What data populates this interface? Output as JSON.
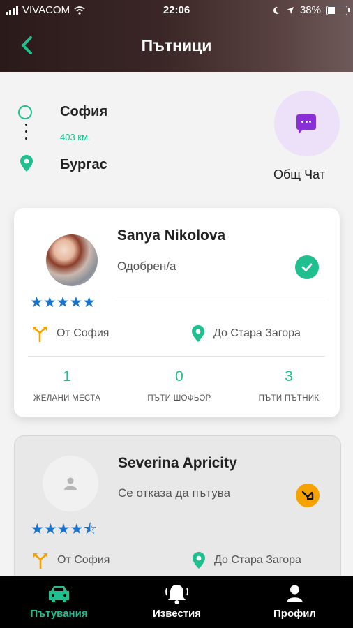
{
  "status_bar": {
    "carrier": "VIVACOM",
    "time": "22:06",
    "battery": "38%"
  },
  "header": {
    "title": "Пътници"
  },
  "route": {
    "from": "София",
    "distance": "403 км.",
    "to": "Бургас"
  },
  "chat": {
    "label": "Общ Чат"
  },
  "passengers": [
    {
      "name": "Sanya Nikolova",
      "status": "Одобрен/а",
      "stars": "★★★★★",
      "rating": 5,
      "from": "От София",
      "to": "До Стара Загора",
      "stats": [
        {
          "value": "1",
          "label": "ЖЕЛАНИ МЕСТА"
        },
        {
          "value": "0",
          "label": "ПЪТИ ШОФЬОР"
        },
        {
          "value": "3",
          "label": "ПЪТИ ПЪТНИК"
        }
      ]
    },
    {
      "name": "Severina Apricity",
      "status": "Се отказа да пътува",
      "stars": "★★★★⯪",
      "rating": 4.5,
      "from": "От София",
      "to": "До Стара Загора"
    }
  ],
  "tabs": [
    {
      "label": "Пътувания",
      "icon": "car-icon"
    },
    {
      "label": "Известия",
      "icon": "bell-icon"
    },
    {
      "label": "Профил",
      "icon": "profile-icon"
    }
  ],
  "colors": {
    "accent": "#1fbf8f",
    "chat": "#8a2fd8",
    "star": "#1a73c9",
    "warning": "#f5a300"
  }
}
